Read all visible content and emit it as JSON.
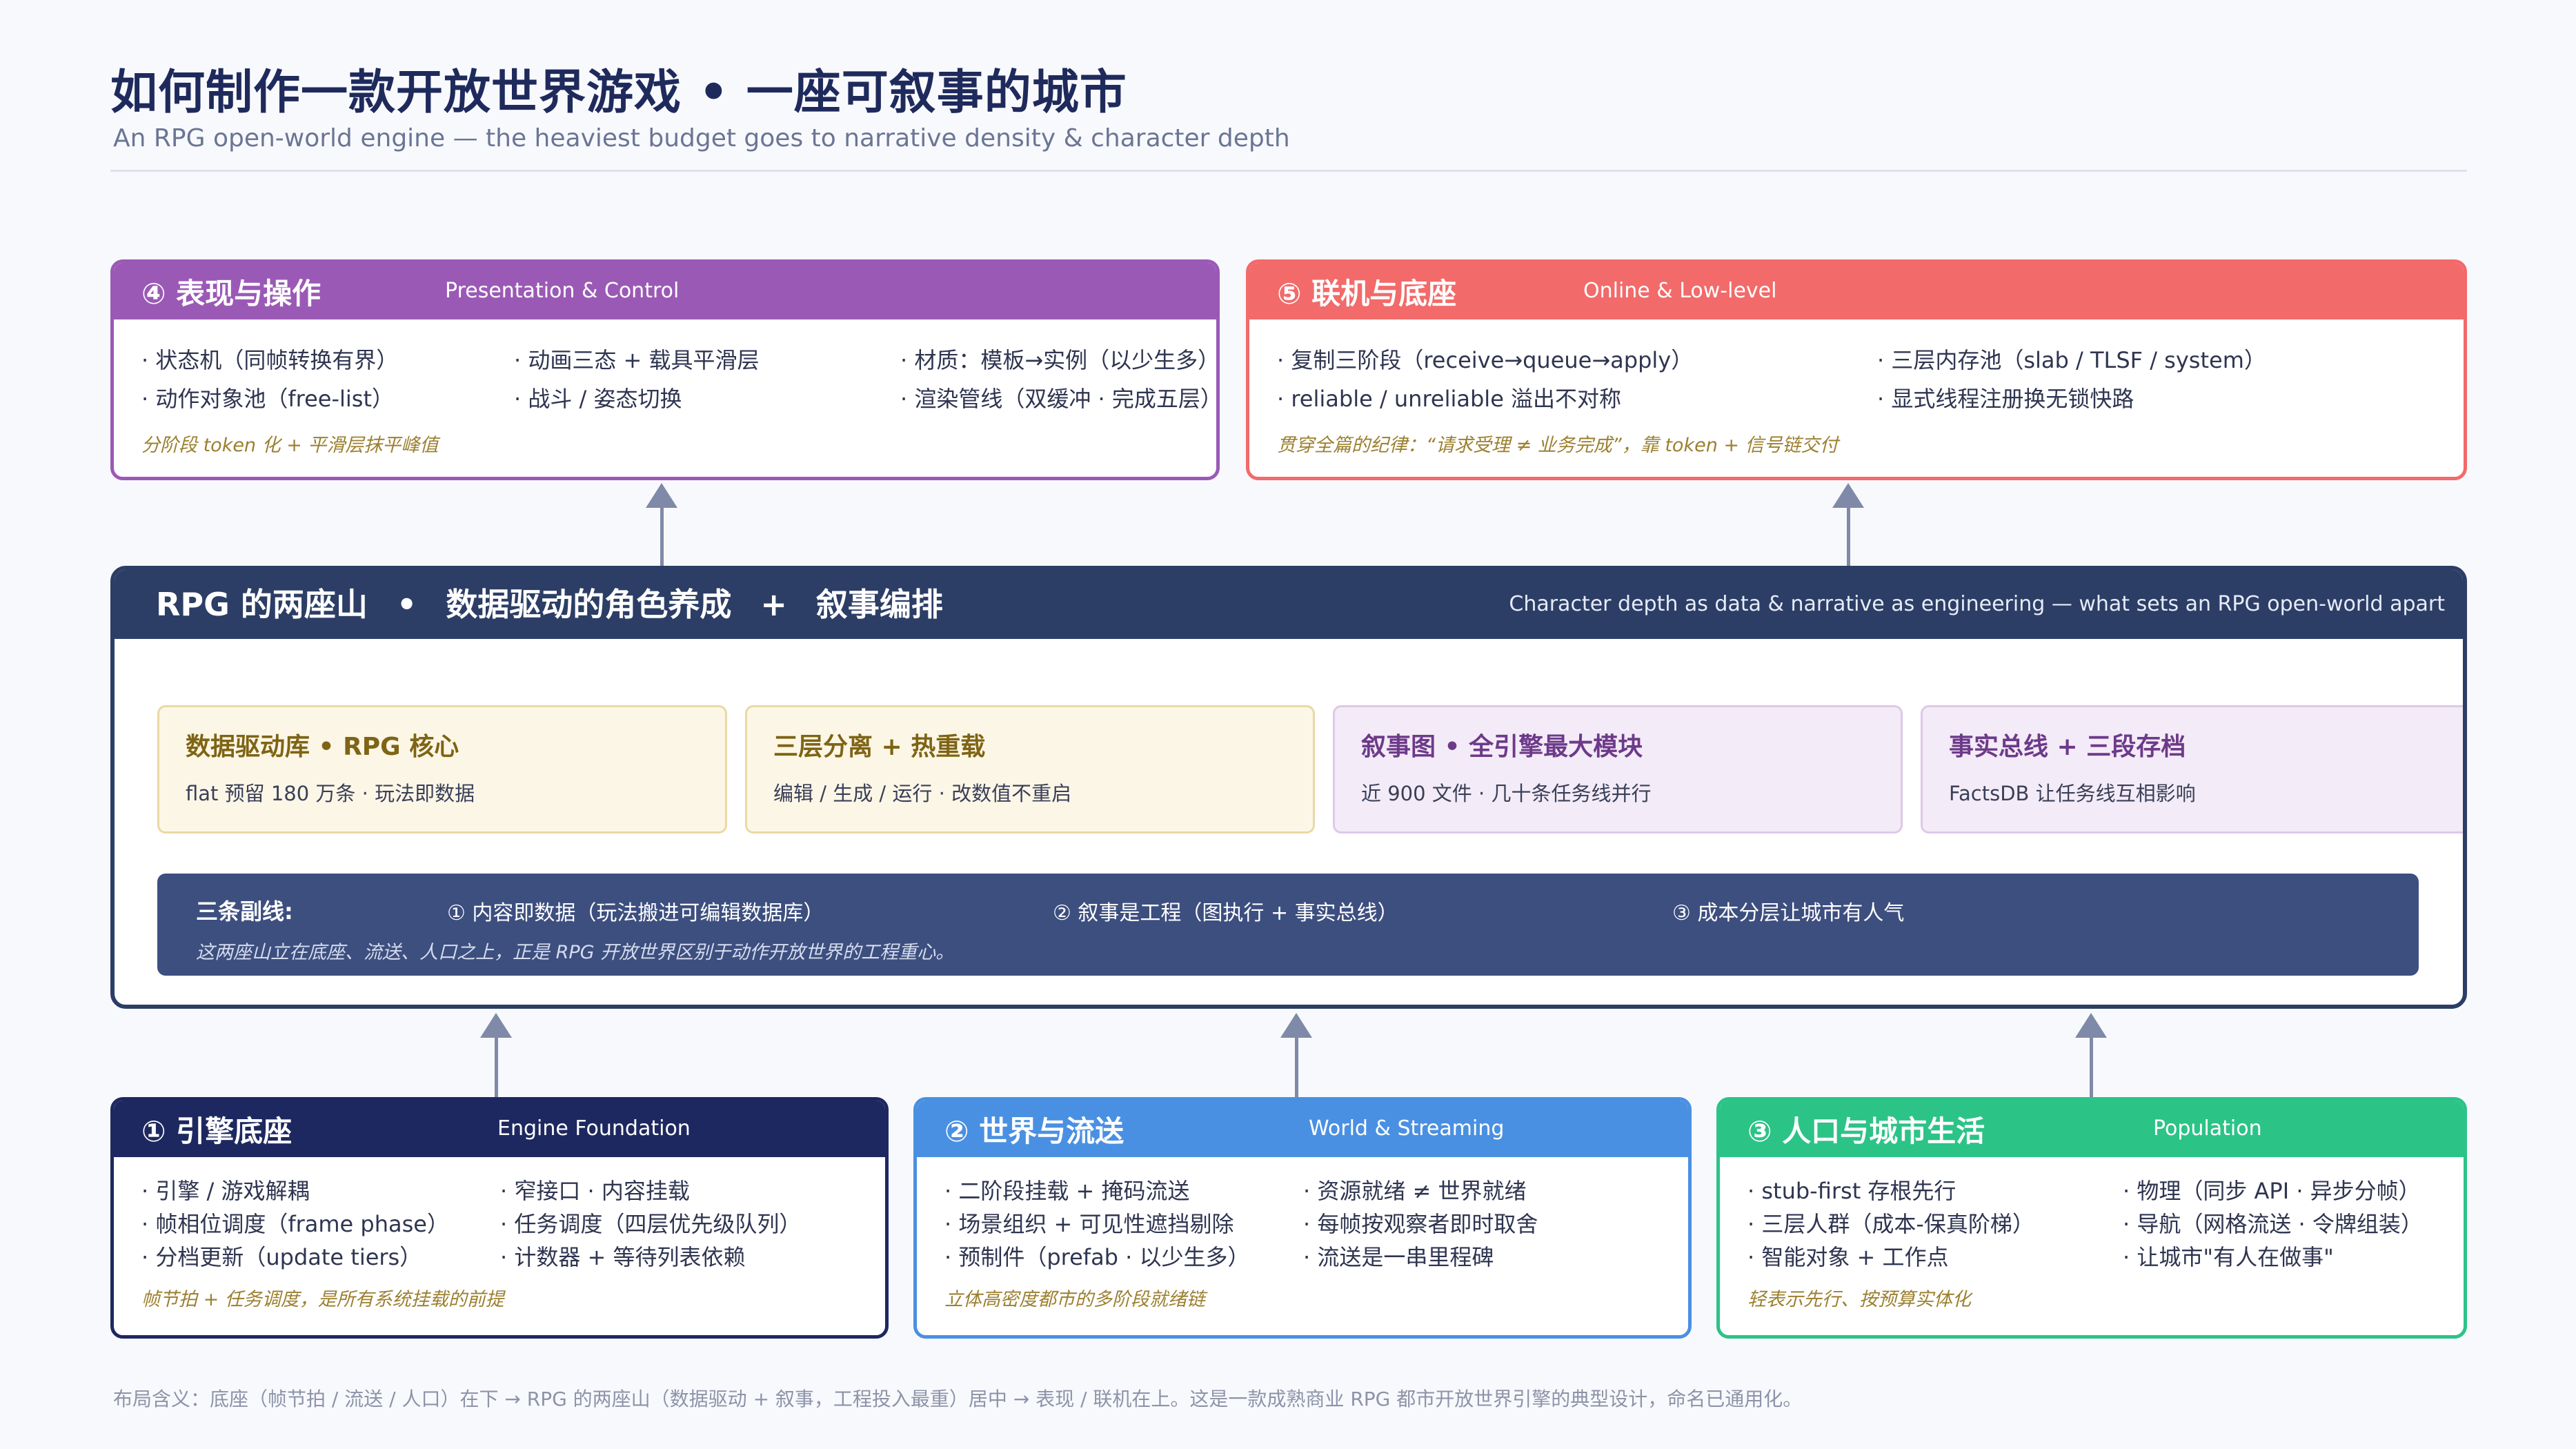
{
  "header": {
    "title": "如何制作一款开放世界游戏 • 一座可叙事的城市",
    "subtitle": "An RPG open-world engine — the heaviest budget goes to narrative density & character depth"
  },
  "module4": {
    "title": "④ 表现与操作",
    "subtitle": "Presentation & Control",
    "items": [
      "· 状态机（同帧转换有界）",
      "· 动作对象池（free-list）",
      "· 动画三态 + 载具平滑层",
      "· 战斗 / 姿态切换",
      "· 材质：模板→实例（以少生多）",
      "· 渲染管线（双缓冲 · 完成五层）"
    ],
    "note": "分阶段 token 化 + 平滑层抹平峰值"
  },
  "module5": {
    "title": "⑤ 联机与底座",
    "subtitle": "Online & Low-level",
    "items": [
      "· 复制三阶段（receive→queue→apply）",
      "· reliable / unreliable 溢出不对称",
      "· 三层内存池（slab / TLSF / system）",
      "· 显式线程注册换无锁快路"
    ],
    "note": "贯穿全篇的纪律：“请求受理 ≠ 业务完成”，靠 token + 信号链交付"
  },
  "core": {
    "title_part1": "RPG 的两座山",
    "title_sep1": "•",
    "title_part2": "数据驱动的角色养成",
    "title_sep2": "+",
    "title_part3": "叙事编排",
    "subtitle": "Character depth as data & narrative as engineering — what sets an RPG open-world apart",
    "cards": [
      {
        "title": "数据驱动库 • RPG 核心",
        "desc": "flat 预留 180 万条 · 玩法即数据"
      },
      {
        "title": "三层分离 + 热重载",
        "desc": "编辑 / 生成 / 运行 · 改数值不重启"
      },
      {
        "title": "叙事图 • 全引擎最大模块",
        "desc": "近 900 文件 · 几十条任务线并行"
      },
      {
        "title": "事实总线 + 三段存档",
        "desc": "FactsDB 让任务线互相影响"
      }
    ],
    "threads": {
      "label": "三条副线:",
      "items": [
        "① 内容即数据（玩法搬进可编辑数据库）",
        "② 叙事是工程（图执行 + 事实总线）",
        "③ 成本分层让城市有人气"
      ],
      "note": "这两座山立在底座、流送、人口之上，正是 RPG 开放世界区别于动作开放世界的工程重心。"
    }
  },
  "module1": {
    "title": "① 引擎底座",
    "subtitle": "Engine Foundation",
    "items": [
      "· 引擎 / 游戏解耦",
      "· 帧相位调度（frame phase）",
      "· 分档更新（update tiers）",
      "· 窄接口 · 内容挂载",
      "· 任务调度（四层优先级队列）",
      "· 计数器 + 等待列表依赖"
    ],
    "note": "帧节拍 + 任务调度，是所有系统挂载的前提"
  },
  "module2": {
    "title": "② 世界与流送",
    "subtitle": "World & Streaming",
    "items": [
      "· 二阶段挂载 + 掩码流送",
      "· 场景组织 + 可见性遮挡剔除",
      "· 预制件（prefab · 以少生多）",
      "· 资源就绪 ≠ 世界就绪",
      "· 每帧按观察者即时取舍",
      "· 流送是一串里程碑"
    ],
    "note": "立体高密度都市的多阶段就绪链"
  },
  "module3": {
    "title": "③ 人口与城市生活",
    "subtitle": "Population",
    "items": [
      "· stub-first 存根先行",
      "· 三层人群（成本-保真阶梯）",
      "· 智能对象 + 工作点",
      "· 物理（同步 API · 异步分帧）",
      "· 导航（网格流送 · 令牌组装）",
      "· 让城市\"有人在做事\""
    ],
    "note": "轻表示先行、按预算实体化"
  },
  "footer": "布局含义：底座（帧节拍 / 流送 / 人口）在下 → RPG 的两座山（数据驱动 + 叙事，工程投入最重）居中 → 表现 / 联机在上。这是一款成熟商业 RPG 都市开放世界引擎的典型设计，命名已通用化。"
}
